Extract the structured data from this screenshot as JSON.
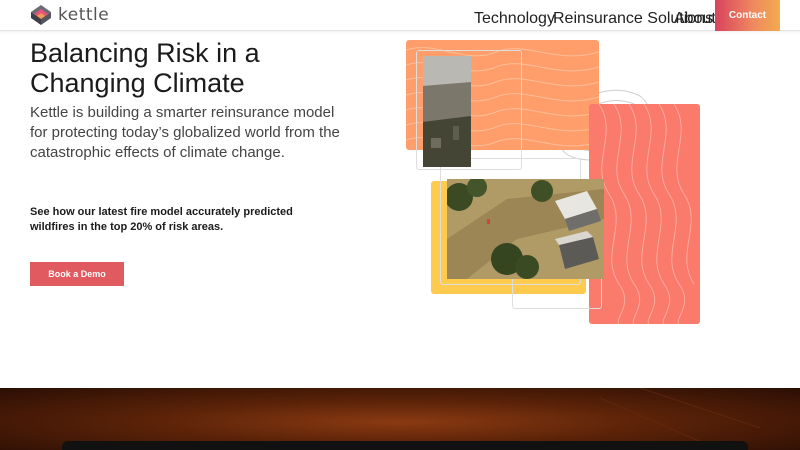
{
  "brand": {
    "name": "kettle"
  },
  "nav": {
    "items": [
      {
        "label": "Technology"
      },
      {
        "label": "Reinsurance Solutions"
      },
      {
        "label": "About"
      }
    ],
    "contact_label": "Contact"
  },
  "hero": {
    "title": "Balancing Risk in a Changing Climate",
    "subtitle": "Kettle is building a smarter reinsurance model for protecting today’s globalized world from the catastrophic effects of climate change.",
    "note": "See how our latest fire model accurately predicted wildfires in the top 20% of risk areas.",
    "cta_label": "Book a Demo"
  },
  "colors": {
    "accent": "#e05a5f",
    "contact_gradient_start": "#d9435e",
    "contact_gradient_end": "#f2ab4e",
    "block_orange": "#ff9d6b",
    "block_pink": "#fa7a6c",
    "block_yellow": "#ffcb4f"
  },
  "icons": {
    "logo": "kettle-logo-icon"
  }
}
